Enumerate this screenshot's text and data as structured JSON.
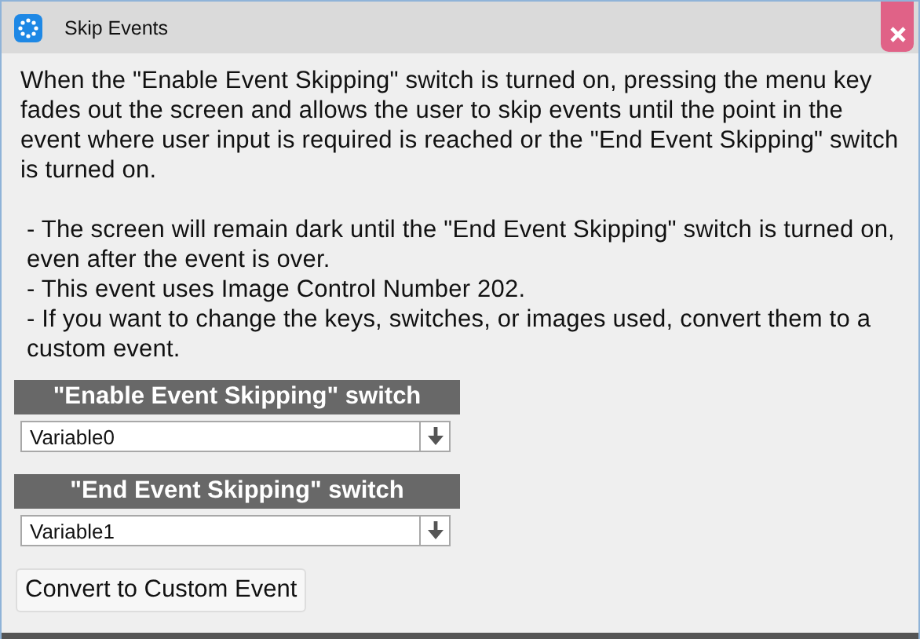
{
  "window": {
    "title": "Skip Events"
  },
  "description": "When the \"Enable Event Skipping\" switch is turned on, pressing the menu key fades out the screen and allows the user to skip events until the point in the event where user input is required is reached or the \"End Event Skipping\" switch is turned on.",
  "notes": [
    "- The screen will remain dark until the \"End Event Skipping\" switch is turned on, even after the event is over.",
    "- This event uses Image Control Number 202.",
    "- If you want to change the keys, switches, or images used, convert them to a custom event."
  ],
  "settings": [
    {
      "heading": "\"Enable Event Skipping\" switch",
      "value": "Variable0"
    },
    {
      "heading": "\"End Event Skipping\" switch",
      "value": "Variable1"
    }
  ],
  "button": "Convert to Custom Event"
}
